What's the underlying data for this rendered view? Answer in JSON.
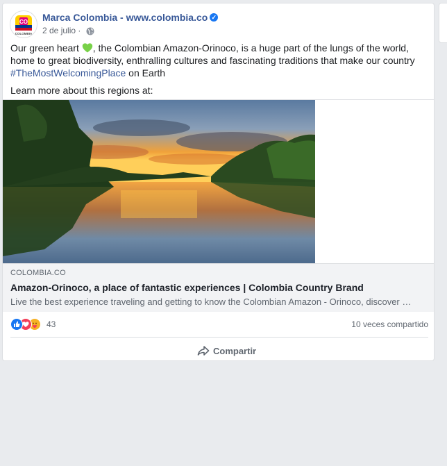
{
  "post": {
    "page_name": "Marca Colombia - www.colombia.co",
    "date": "2 de julio",
    "separator": "·",
    "avatar_text": "CO",
    "avatar_subtext": "COLOMBIA",
    "text_part1": "Our green heart ",
    "text_part2": ", the Colombian Amazon-Orinoco, is a huge part of the lungs of the world, home to great biodiversity, enthralling cultures and fascinating traditions that make our country ",
    "hashtag": "#TheMostWelcomingPlace",
    "text_part3": " on Earth",
    "learn_more": "Learn more about this regions at:"
  },
  "link": {
    "domain": "COLOMBIA.CO",
    "title": "Amazon-Orinoco, a place of fantastic experiences | Colombia Country Brand",
    "description": "Live the best experience traveling and getting to know the Colombian Amazon - Orinoco, discover an..."
  },
  "engagement": {
    "reaction_count": "43",
    "reaction_icons": [
      "like-icon",
      "love-icon",
      "care-icon"
    ],
    "shares": "10 veces compartido"
  },
  "actions": {
    "share_label": "Compartir"
  },
  "colors": {
    "link_blue": "#385898",
    "like_blue": "#1877f2",
    "love_red": "#f33e58",
    "care_yellow": "#f7b125",
    "heart_green": "#78d148"
  }
}
